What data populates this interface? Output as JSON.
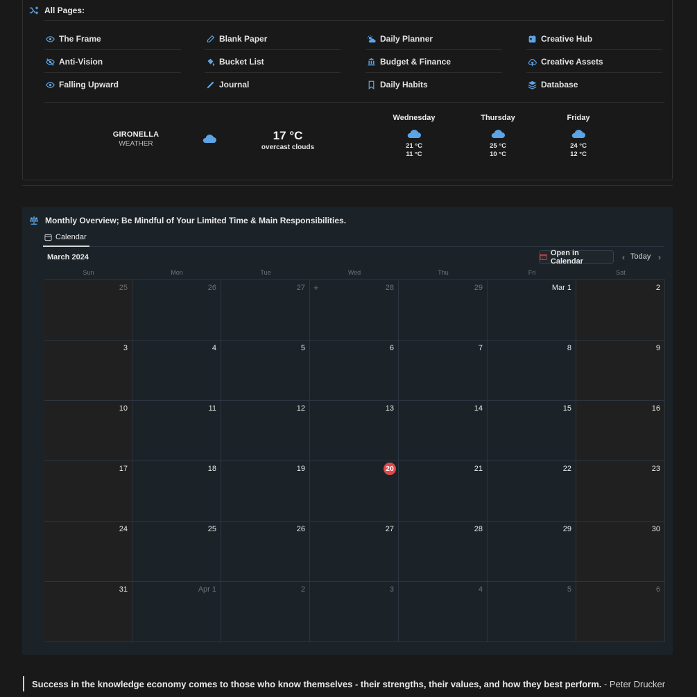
{
  "all_pages": {
    "title": "All Pages:",
    "links": [
      {
        "label": "The Frame",
        "icon": "eye-icon"
      },
      {
        "label": "Blank Paper",
        "icon": "pen-icon"
      },
      {
        "label": "Daily Planner",
        "icon": "sun-cloud-icon"
      },
      {
        "label": "Creative Hub",
        "icon": "calendar-box-icon"
      },
      {
        "label": "Anti-Vision",
        "icon": "eye-slash-icon"
      },
      {
        "label": "Bucket List",
        "icon": "paint-bucket-icon"
      },
      {
        "label": "Budget & Finance",
        "icon": "bank-icon"
      },
      {
        "label": "Creative Assets",
        "icon": "cloud-upload-icon"
      },
      {
        "label": "Falling Upward",
        "icon": "eye-icon"
      },
      {
        "label": "Journal",
        "icon": "pencil-icon"
      },
      {
        "label": "Daily Habits",
        "icon": "bookmark-icon"
      },
      {
        "label": "Database",
        "icon": "layers-icon"
      }
    ]
  },
  "weather": {
    "city": "GIRONELLA",
    "city_sub": "WEATHER",
    "current_temp": "17 °C",
    "current_desc": "overcast clouds",
    "forecast": [
      {
        "day": "Wednesday",
        "high": "21 °C",
        "low": "11 °C"
      },
      {
        "day": "Thursday",
        "high": "25 °C",
        "low": "10 °C"
      },
      {
        "day": "Friday",
        "high": "24 °C",
        "low": "12 °C"
      }
    ]
  },
  "calendar": {
    "heading": "Monthly Overview; Be Mindful of Your Limited Time & Main Responsibilities.",
    "tab": "Calendar",
    "month": "March 2024",
    "open_button": "Open in Calendar",
    "today_button": "Today",
    "weekdays": [
      "Sun",
      "Mon",
      "Tue",
      "Wed",
      "Thu",
      "Fri",
      "Sat"
    ],
    "weeks": [
      [
        "25",
        "26",
        "27",
        "28",
        "29",
        "Mar 1",
        "2"
      ],
      [
        "3",
        "4",
        "5",
        "6",
        "7",
        "8",
        "9"
      ],
      [
        "10",
        "11",
        "12",
        "13",
        "14",
        "15",
        "16"
      ],
      [
        "17",
        "18",
        "19",
        "20",
        "21",
        "22",
        "23"
      ],
      [
        "24",
        "25",
        "26",
        "27",
        "28",
        "29",
        "30"
      ],
      [
        "31",
        "Apr 1",
        "2",
        "3",
        "4",
        "5",
        "6"
      ]
    ],
    "today": "20"
  },
  "quote": {
    "text": "Success in the knowledge economy comes to those who know themselves - their strengths, their values, and how they best perform.",
    "author": " - Peter Drucker"
  },
  "colors": {
    "accent_blue": "#5ba4e6",
    "today_red": "#e0484a",
    "background": "#191919",
    "calendar_bg": "#1b2329"
  }
}
